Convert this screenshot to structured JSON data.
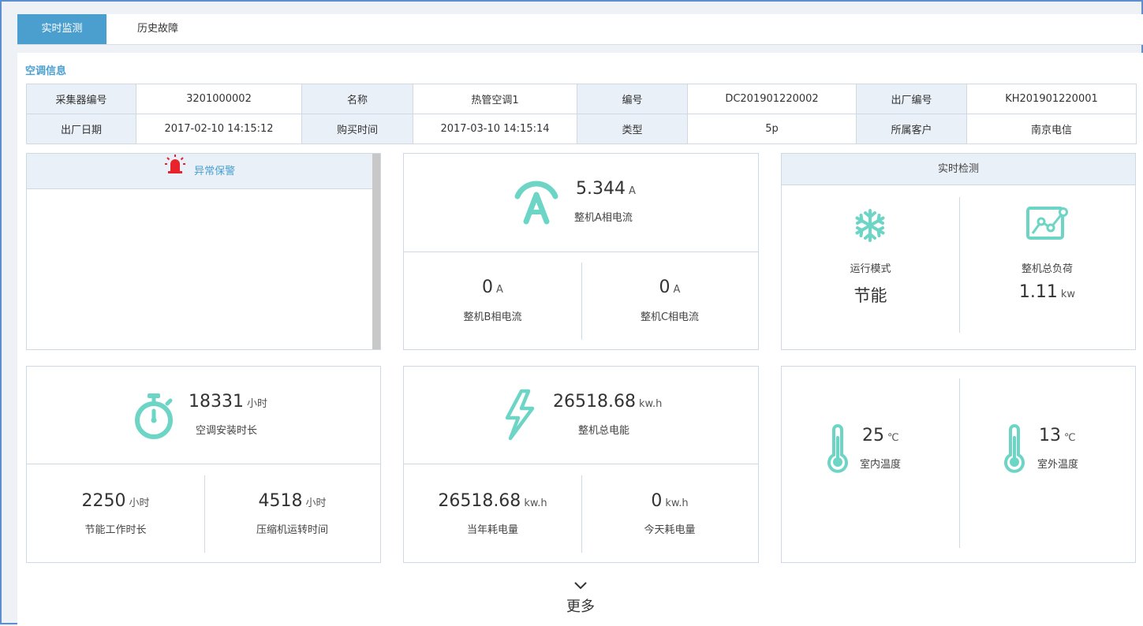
{
  "tabs": [
    {
      "label": "实时监测",
      "active": true
    },
    {
      "label": "历史故障",
      "active": false
    }
  ],
  "section_title": "空调信息",
  "info_rows": [
    [
      {
        "label": "采集器编号",
        "value": "3201000002"
      },
      {
        "label": "名称",
        "value": "热管空调1"
      },
      {
        "label": "编号",
        "value": "DC201901220002"
      },
      {
        "label": "出厂编号",
        "value": "KH201901220001"
      }
    ],
    [
      {
        "label": "出厂日期",
        "value": "2017-02-10 14:15:12"
      },
      {
        "label": "购买时间",
        "value": "2017-03-10 14:15:14"
      },
      {
        "label": "类型",
        "value": "5p"
      },
      {
        "label": "所属客户",
        "value": "南京电信"
      }
    ]
  ],
  "alarm": {
    "title": "异常保警"
  },
  "current": {
    "a": {
      "value": "5.344",
      "unit": "A",
      "label": "整机A相电流"
    },
    "b": {
      "value": "0",
      "unit": "A",
      "label": "整机B相电流"
    },
    "c": {
      "value": "0",
      "unit": "A",
      "label": "整机C相电流"
    }
  },
  "realtime": {
    "title": "实时检测",
    "mode": {
      "label": "运行模式",
      "value": "节能"
    },
    "load": {
      "label": "整机总负荷",
      "value": "1.11",
      "unit": "kw"
    }
  },
  "time": {
    "install": {
      "value": "18331",
      "unit": "小时",
      "label": "空调安装时长"
    },
    "saving": {
      "value": "2250",
      "unit": "小时",
      "label": "节能工作时长"
    },
    "compressor": {
      "value": "4518",
      "unit": "小时",
      "label": "压缩机运转时间"
    }
  },
  "energy": {
    "total": {
      "value": "26518.68",
      "unit": "kw.h",
      "label": "整机总电能"
    },
    "year": {
      "value": "26518.68",
      "unit": "kw.h",
      "label": "当年耗电量"
    },
    "today": {
      "value": "0",
      "unit": "kw.h",
      "label": "今天耗电量"
    }
  },
  "temperature": {
    "indoor": {
      "value": "25",
      "unit": "℃",
      "label": "室内温度"
    },
    "outdoor": {
      "value": "13",
      "unit": "℃",
      "label": "室外温度"
    }
  },
  "more_label": "更多",
  "colors": {
    "accent": "#4b9fcf",
    "icon": "#6dd5c5",
    "alarm": "#e8232c"
  }
}
